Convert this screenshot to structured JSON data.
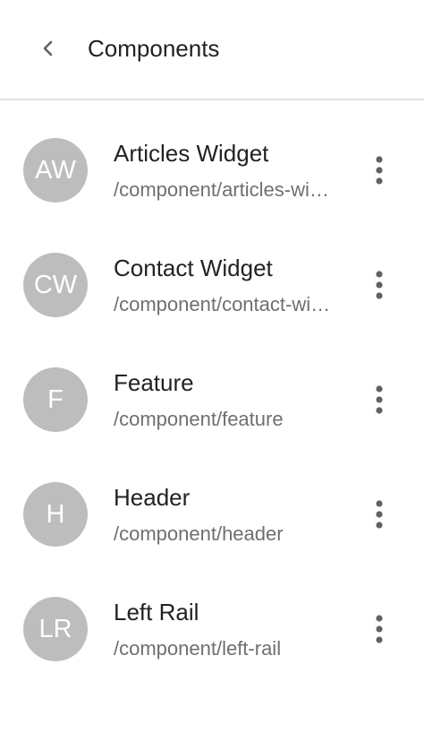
{
  "header": {
    "title": "Components",
    "back_icon": "chevron-left-icon"
  },
  "components": [
    {
      "initials": "AW",
      "name": "Articles Widget",
      "path": "/component/articles-widget"
    },
    {
      "initials": "CW",
      "name": "Contact Widget",
      "path": "/component/contact-widget"
    },
    {
      "initials": "F",
      "name": "Feature",
      "path": "/component/feature"
    },
    {
      "initials": "H",
      "name": "Header",
      "path": "/component/header"
    },
    {
      "initials": "LR",
      "name": "Left Rail",
      "path": "/component/left-rail"
    }
  ],
  "item_menu_icon": "more-vertical-icon",
  "colors": {
    "avatar_bg": "#bdbdbd",
    "title_text": "#222222",
    "secondary_text": "#6f6f6f",
    "divider": "#e2e2e2",
    "icon": "#616161"
  }
}
